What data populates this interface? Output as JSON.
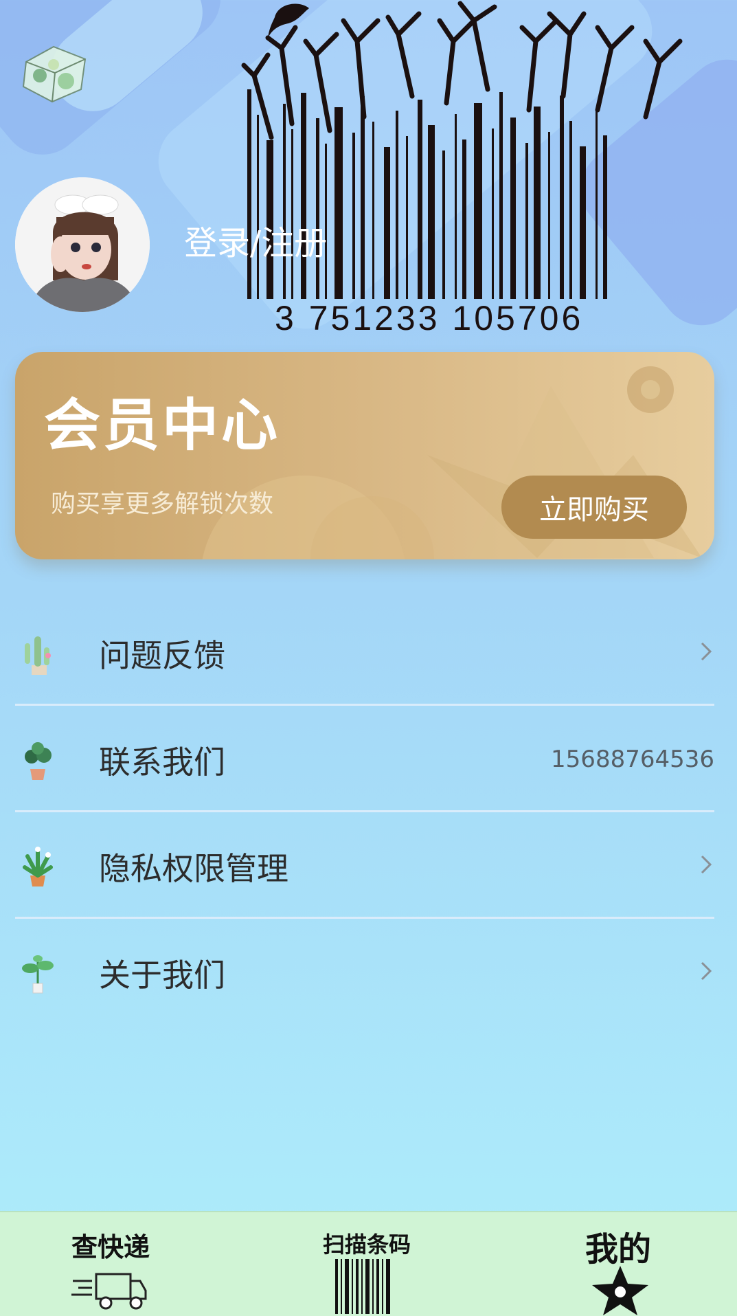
{
  "header": {
    "login_text": "登录/注册",
    "barcode_number": "3 751233 105706"
  },
  "member_card": {
    "title": "会员中心",
    "subtitle": "购买享更多解锁次数",
    "buy_label": "立即购买"
  },
  "menu": [
    {
      "label": "问题反馈",
      "icon": "cactus-plant-icon",
      "value": ""
    },
    {
      "label": "联系我们",
      "icon": "potted-plant-icon",
      "value": "15688764536"
    },
    {
      "label": "隐私权限管理",
      "icon": "flower-pot-icon",
      "value": ""
    },
    {
      "label": "关于我们",
      "icon": "sprout-plant-icon",
      "value": ""
    }
  ],
  "tabbar": {
    "tabs": [
      {
        "label": "查快递",
        "icon": "delivery-truck-icon"
      },
      {
        "label": "扫描条码",
        "icon": "barcode-icon"
      },
      {
        "label": "我的",
        "icon": "star-icon"
      }
    ]
  },
  "colors": {
    "card_gold": "#c9a46a",
    "buy_button": "#b28b50",
    "tabbar_bg": "#d0f4d5"
  }
}
